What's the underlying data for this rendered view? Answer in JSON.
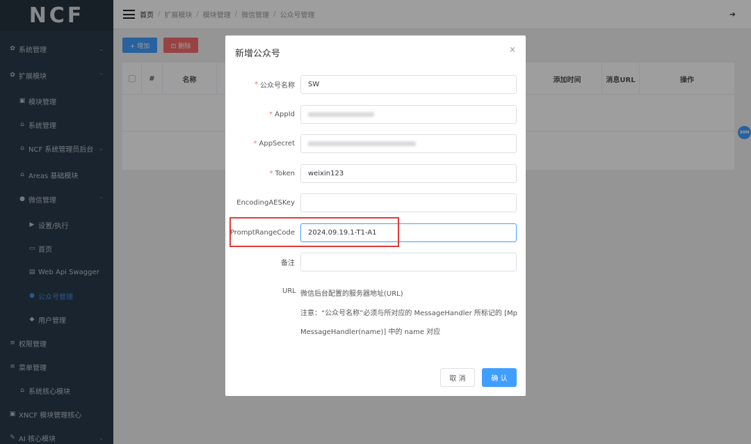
{
  "app": {
    "logo": "NCF"
  },
  "sidebar": {
    "items": [
      {
        "label": "系统管理",
        "icon": "gear-icon",
        "glyph": "✿",
        "chev": "⌄"
      },
      {
        "label": "扩展模块",
        "icon": "gear-icon",
        "glyph": "✿",
        "chev": "⌃"
      },
      {
        "label": "模块管理",
        "icon": "lock-icon",
        "glyph": "▣"
      },
      {
        "label": "系统管理",
        "icon": "bank-icon",
        "glyph": "⌂"
      },
      {
        "label": "NCF 系统管理员后台",
        "icon": "bank-icon",
        "glyph": "⌂",
        "chev": "⌄"
      },
      {
        "label": "Areas 基础模块",
        "icon": "bank-icon",
        "glyph": "⌂"
      },
      {
        "label": "微信管理",
        "icon": "wechat-icon",
        "glyph": "●",
        "chev": "⌃"
      },
      {
        "label": "设置/执行",
        "icon": "play-icon",
        "glyph": "▶"
      },
      {
        "label": "首页",
        "icon": "monitor-icon",
        "glyph": "▭"
      },
      {
        "label": "Web Api Swagger",
        "icon": "file-icon",
        "glyph": "▤"
      },
      {
        "label": "公众号管理",
        "icon": "wechat-icon",
        "glyph": "●"
      },
      {
        "label": "用户管理",
        "icon": "users-icon",
        "glyph": "◆"
      },
      {
        "label": "权限管理",
        "icon": "list-icon",
        "glyph": "≡"
      },
      {
        "label": "菜单管理",
        "icon": "list-icon",
        "glyph": "≡"
      },
      {
        "label": "系统核心模块",
        "icon": "bank-icon",
        "glyph": "⌂"
      },
      {
        "label": "XNCF 模块管理核心",
        "icon": "lock-icon",
        "glyph": "▣"
      },
      {
        "label": "AI 核心模块",
        "icon": "magic-icon",
        "glyph": "✎",
        "chev": "⌄"
      }
    ]
  },
  "breadcrumb": [
    "首页",
    "扩展模块",
    "模块管理",
    "微信管理",
    "公众号管理"
  ],
  "toolbar": {
    "add_label": "+ 增加",
    "delete_label": "⊡ 删除"
  },
  "table": {
    "headers": [
      "#",
      "名称",
      "添加时间",
      "消息URL",
      "操作"
    ]
  },
  "float_badge": "30M",
  "dialog": {
    "title": "新增公众号",
    "close": "×",
    "fields": [
      {
        "label": "公众号名称",
        "required": "*",
        "value": "SW"
      },
      {
        "label": "AppId",
        "required": "*",
        "value": ""
      },
      {
        "label": "AppSecret",
        "required": "*",
        "value": ""
      },
      {
        "label": "Token",
        "required": "*",
        "value": "weixin123"
      },
      {
        "label": "EncodingAESKey",
        "required": "",
        "value": ""
      },
      {
        "label": "PromptRangeCode",
        "required": "",
        "value": "2024.09.19.1-T1-A1"
      },
      {
        "label": "备注",
        "required": "",
        "value": ""
      }
    ],
    "url_label": "URL",
    "url_lines": [
      "微信后台配置的服务器地址(URL)",
      "注意：“公众号名称”必须与所对应的 MessageHandler 所标记的 [Mp",
      "MessageHandler(name)] 中的 name 对应"
    ],
    "cancel_label": "取 消",
    "confirm_label": "确 认"
  },
  "colors": {
    "primary": "#409eff",
    "danger": "#f56c6c",
    "sidebar_bg": "#2b3b4b",
    "highlight": "#e53935"
  }
}
